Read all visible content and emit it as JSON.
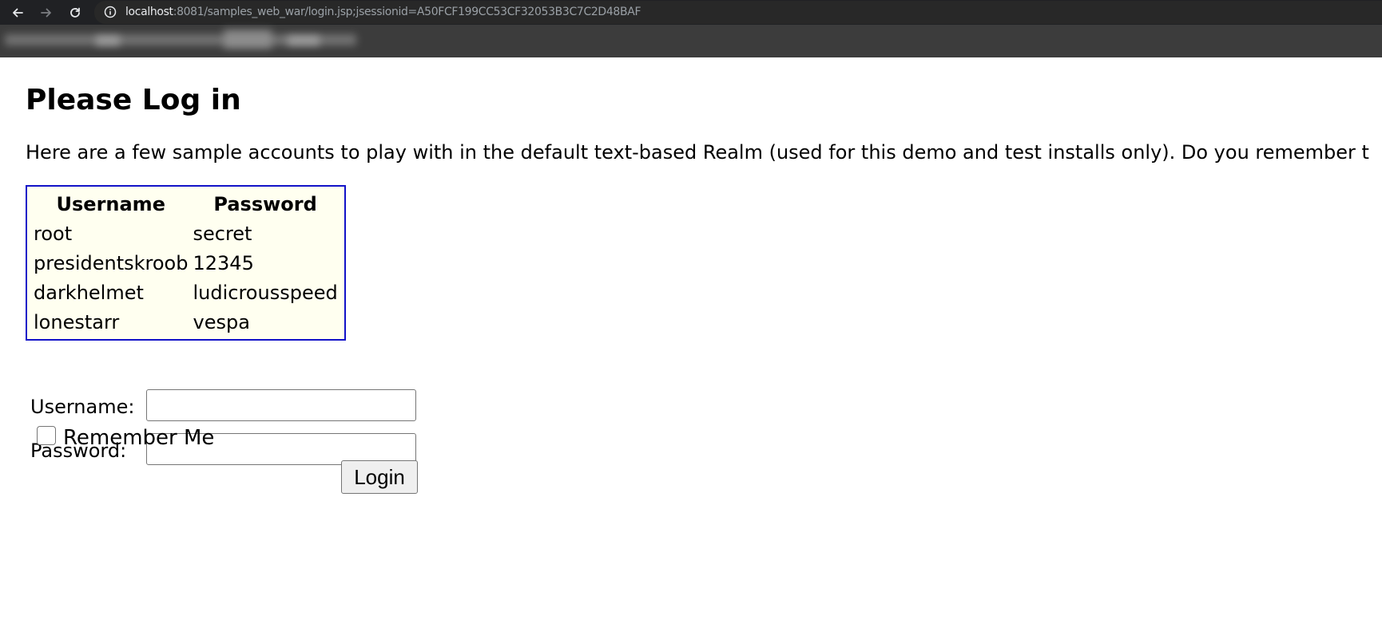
{
  "browser": {
    "url_host": "localhost",
    "url_rest": ":8081/samples_web_war/login.jsp;jsessionid=A50FCF199CC53CF32053B3C7C2D48BAF",
    "icons": [
      "back-arrow-icon",
      "forward-arrow-icon",
      "reload-icon",
      "site-info-icon"
    ]
  },
  "page": {
    "title": "Please Log in",
    "intro": "Here are a few sample accounts to play with in the default text-based Realm (used for this demo and test installs only). Do you remember t"
  },
  "accounts_table": {
    "headers": [
      "Username",
      "Password"
    ],
    "rows": [
      [
        "root",
        "secret"
      ],
      [
        "presidentskroob",
        "12345"
      ],
      [
        "darkhelmet",
        "ludicrousspeed"
      ],
      [
        "lonestarr",
        "vespa"
      ]
    ],
    "border_color": "#1212c8",
    "background_color": "#fffff0"
  },
  "form": {
    "username_label": "Username:",
    "username_value": "",
    "password_label": "Password:",
    "password_value": "",
    "remember_label": "Remember Me",
    "remember_checked": false,
    "login_label": "Login"
  }
}
